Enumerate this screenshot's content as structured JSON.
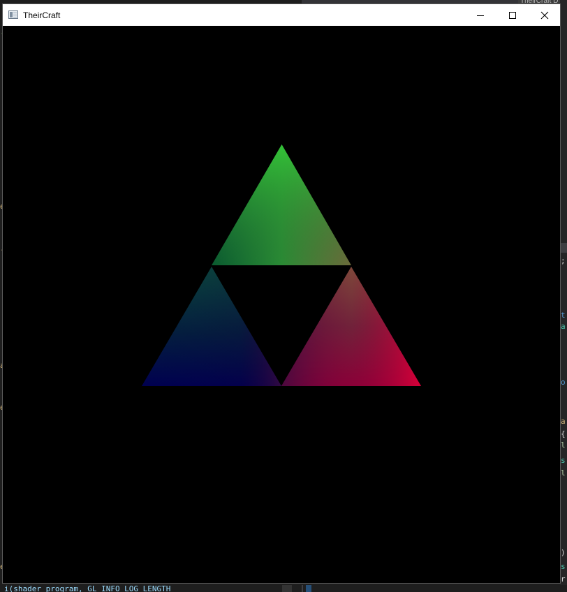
{
  "window": {
    "title": "TheirCraft",
    "buttons": {
      "minimize": "minimize",
      "maximize": "maximize",
      "close": "close"
    }
  },
  "background_app": {
    "tab_title": "TheirCraft D",
    "bottom_code_line": "i(shader_program, GL_INFO_LOG_LENGTH"
  },
  "scene": {
    "description_colors": {
      "background": "#000000",
      "top_apex": "#33c237",
      "top_left_base": "#0a5a30",
      "top_right_base": "#6b6a3a",
      "bottom_left_apex": "#0a4a3c",
      "bottom_left_base": "#000060",
      "center_bottom": "#3a0a40",
      "bottom_right_apex": "#7a4a3a",
      "bottom_right_base": "#d3003a"
    }
  }
}
